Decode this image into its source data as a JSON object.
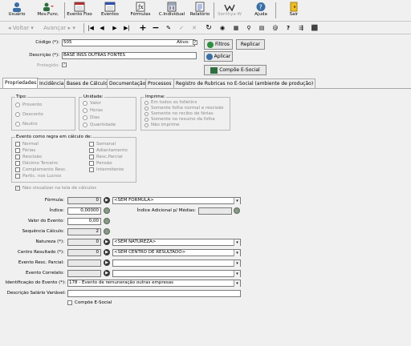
{
  "toolbar": {
    "items": [
      {
        "label": "Usuário",
        "icon": "users-icon"
      },
      {
        "label": "Mov.Func.",
        "icon": "employee-movement-icon"
      },
      {
        "label": "Evento Fixo",
        "icon": "calendar-fixed-icon"
      },
      {
        "label": "Eventos",
        "icon": "calendar-events-icon"
      },
      {
        "label": "Fórmulas",
        "icon": "formula-icon"
      },
      {
        "label": "C.Individual",
        "icon": "individual-calc-icon"
      },
      {
        "label": "Relatório",
        "icon": "report-icon"
      },
      {
        "label": "Senthya-W",
        "icon": "senthya-icon"
      },
      {
        "label": "Ajuda",
        "icon": "help-icon"
      },
      {
        "label": "Sair",
        "icon": "exit-icon"
      }
    ]
  },
  "nav": {
    "back": "Voltar",
    "forward": "Avançar"
  },
  "form": {
    "codigo_label": "Código (*):",
    "codigo_value": "505",
    "ativo_label": "Ativo:",
    "ativo_checked": "✓",
    "descricao_label": "Descrição (*):",
    "descricao_value": "BASE INSS OUTRAS FONTES",
    "protegido_label": "Protegido:",
    "protegido_checked": "✓"
  },
  "buttons": {
    "filtros": "Filtros",
    "replicar": "Replicar",
    "aplicar": "Aplicar",
    "compoe": "Compõe E-Social"
  },
  "tabs": [
    "Propriedades",
    "Incidência",
    "Bases de Cálculo",
    "Documentação",
    "Processos",
    "Registro de Rubricas no E-Social (ambiente de produção)"
  ],
  "tipo": {
    "title": "Tipo:",
    "options": [
      "Provento",
      "Desconto",
      "Neutro"
    ]
  },
  "unidade": {
    "title": "Unidade:",
    "options": [
      "Valor",
      "Horas",
      "Dias",
      "Quantidade"
    ]
  },
  "imprime": {
    "title": "Imprime:",
    "options": [
      "Em todos os folletins",
      "Somente folha normal e rescisão",
      "Somente no recibo de férias",
      "Somente no resumo da folha",
      "Não imprime"
    ]
  },
  "regra": {
    "title": "Evento como regra em cálculo de:",
    "col1": [
      "Normal",
      "Férias",
      "Rescisão",
      "Décimo Terceiro",
      "Complemento Resc.",
      "Partic. nos Lucros"
    ],
    "col2": [
      "Semanal",
      "Adiantamento",
      "Resc.Parcial",
      "Pensão",
      "Intermitente"
    ]
  },
  "nao_visualizar": "Não visualizar na tela de cálculos",
  "fields": {
    "formula_label": "Fórmula:",
    "formula_num": "0",
    "formula_value": "<SEM FORMULA>",
    "indice_label": "Índice:",
    "indice_value": "0,00000",
    "indice_adicional_label": "Índice Adicional p/ Médias:",
    "valor_label": "Valor do Evento:",
    "valor_value": "0,00",
    "sequencia_label": "Sequência Cálculo:",
    "sequencia_value": "2",
    "natureza_label": "Natureza (*):",
    "natureza_num": "0",
    "natureza_value": "<SEM NATUREZA>",
    "centro_label": "Centro Resultado (*):",
    "centro_num": "0",
    "centro_value": "<SEM CENTRO DE RESULTADO>",
    "resc_parcial_label": "Evento Resc. Parcial:",
    "correlato_label": "Evento Correlato:",
    "identificacao_label": "Identificação do Evento (*):",
    "identificacao_value": "178 - Evento de remuneração outras empresas",
    "desc_salario_label": "Descrição Salário Variável:",
    "compoe_label": "Compõe E-Social"
  }
}
